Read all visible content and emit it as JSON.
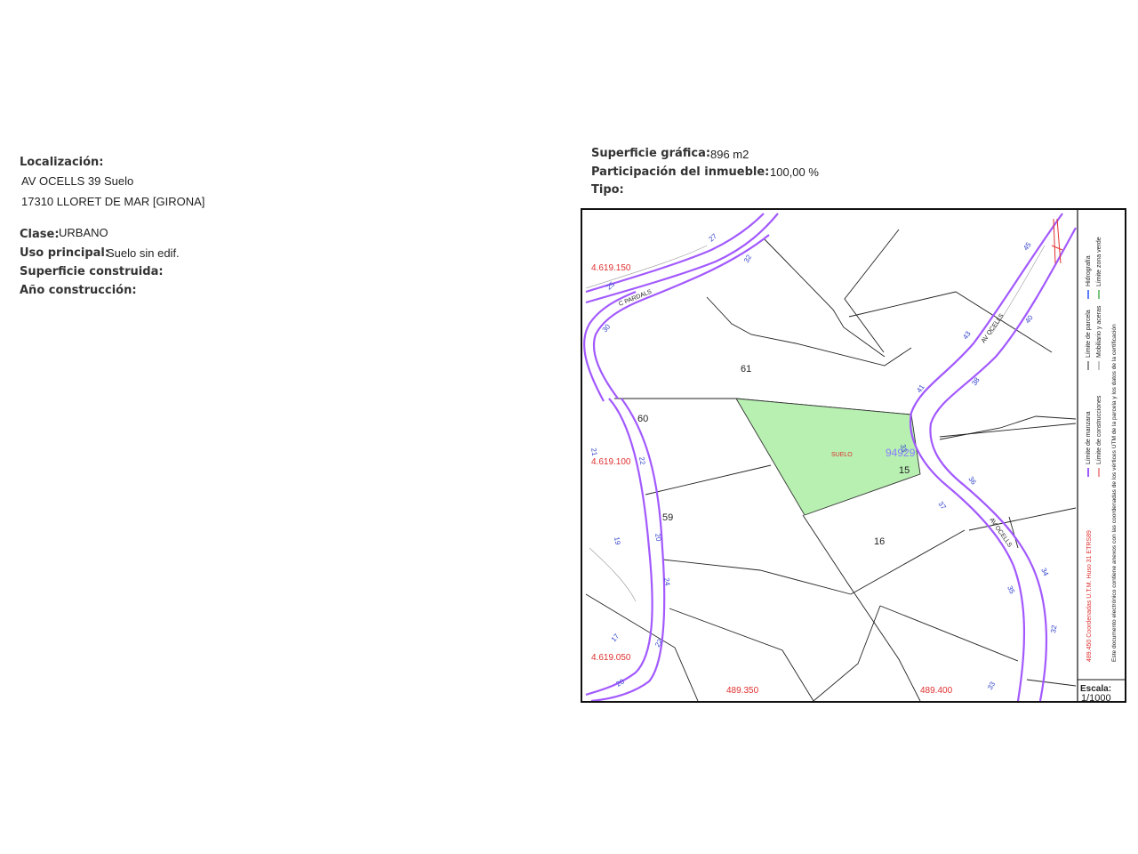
{
  "localizacion": {
    "label": "Localización:",
    "line1": "AV OCELLS 39 Suelo",
    "line2": "17310 LLORET DE MAR [GIRONA]"
  },
  "clase": {
    "label": "Clase:",
    "value": "URBANO"
  },
  "uso": {
    "label": "Uso principal:",
    "value": "Suelo sin edif."
  },
  "sup_construida": {
    "label": "Superficie construida:"
  },
  "anio": {
    "label": "Año construcción:"
  },
  "sup_grafica": {
    "label": "Superficie gráfica:",
    "value": "896 m2"
  },
  "participacion": {
    "label": "Participación del inmueble:",
    "value": "100,00 %"
  },
  "tipo": {
    "label": "Tipo:"
  },
  "map": {
    "coords": {
      "y1": "4.619.150",
      "y2": "4.619.100",
      "y3": "4.619.050",
      "x1": "489.350",
      "x2": "489.400"
    },
    "streets": {
      "pardals": "C PARDALS",
      "ocells_top": "AV OCELLS",
      "ocells_bottom": "AV OCELLS"
    },
    "parcels": {
      "p61": "61",
      "p60": "60",
      "p59": "59",
      "p15": "15",
      "p16": "16"
    },
    "parcel_ref": "94929",
    "suelo_label": "SUELO",
    "house_numbers": [
      "27",
      "25",
      "32",
      "30",
      "21",
      "22",
      "19",
      "20",
      "24",
      "17",
      "22",
      "20",
      "45",
      "43",
      "40",
      "41",
      "38",
      "33",
      "36",
      "37",
      "35",
      "34",
      "32",
      "33"
    ],
    "colors": {
      "street_line": "#a259ff",
      "highlight_fill": "#b7f0b1",
      "coord_red": "#e03030",
      "number_blue": "#3344cc"
    }
  },
  "legend": {
    "items": [
      "Límite de manzana",
      "Límite de parcela",
      "Hidrografía",
      "Límite de construcciones",
      "Mobiliario y aceras",
      "Límite zona verde"
    ],
    "coord_note": "489.450 Coordenadas U.T.M. Huso 31 ETRS89",
    "doc_note": "Este documento electrónico contiene anexos con las coordenadas de los vértices UTM de la parcela y los datos de la certificación",
    "scale_label": "Escala:",
    "scale_value": "1/1000"
  }
}
